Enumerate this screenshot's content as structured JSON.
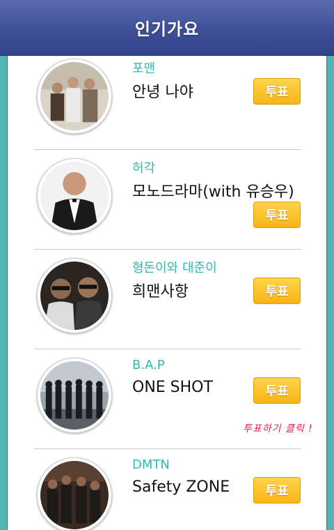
{
  "header": {
    "title": "인기가요"
  },
  "rows": [
    {
      "artist": "포맨",
      "song": "안녕 나야",
      "vote_label": "투표"
    },
    {
      "artist": "허각",
      "song": "모노드라마(with 유승우)",
      "vote_label": "투표"
    },
    {
      "artist": "형돈이와 대준이",
      "song": "희맨사항",
      "vote_label": "투표"
    },
    {
      "artist": "B.A.P",
      "song": "ONE SHOT",
      "vote_label": "투표",
      "hint": "투표하기 클릭 !"
    },
    {
      "artist": "DMTN",
      "song": "Safety ZONE",
      "vote_label": "투표"
    }
  ],
  "colors": {
    "header_bg": "#3e4f97",
    "frame": "#52b3b2",
    "artist_text": "#30b8b0",
    "vote_button": "#f7b514",
    "hint_text": "#e8175d"
  }
}
